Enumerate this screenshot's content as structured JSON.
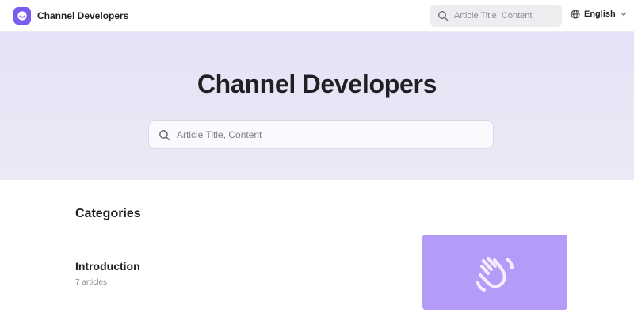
{
  "header": {
    "brand": "Channel Developers",
    "search_placeholder": "Article Title, Content",
    "language": "English",
    "logo_color": "#7b5cf0"
  },
  "hero": {
    "title": "Channel Developers",
    "search_placeholder": "Article Title, Content"
  },
  "categories": {
    "heading": "Categories",
    "items": [
      {
        "title": "Introduction",
        "count": "7 articles",
        "icon": "waving-hand-icon",
        "thumb_color": "#b49bf7"
      }
    ]
  }
}
